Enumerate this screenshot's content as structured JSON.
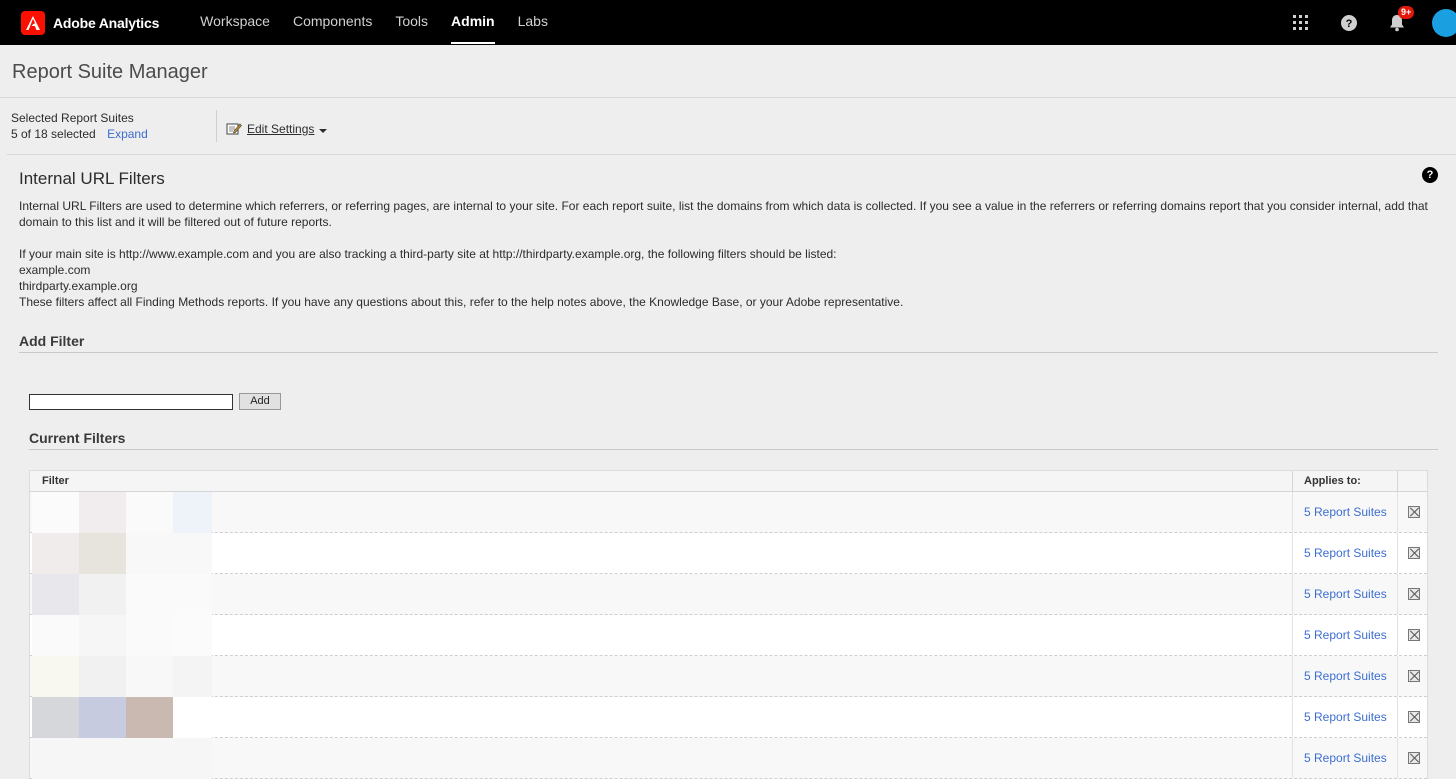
{
  "topbar": {
    "brand": "Adobe Analytics",
    "nav": [
      {
        "label": "Workspace",
        "active": false
      },
      {
        "label": "Components",
        "active": false
      },
      {
        "label": "Tools",
        "active": false
      },
      {
        "label": "Admin",
        "active": true
      },
      {
        "label": "Labs",
        "active": false
      }
    ],
    "notification_badge": "9+",
    "icons": [
      "apps-grid-icon",
      "help-icon",
      "bell-icon",
      "avatar"
    ]
  },
  "page": {
    "title": "Report Suite Manager"
  },
  "selected_suites": {
    "label": "Selected Report Suites",
    "count": "5 of 18 selected",
    "expand": "Expand"
  },
  "toolbar": {
    "edit_settings": "Edit Settings"
  },
  "section": {
    "title": "Internal URL Filters",
    "help": "?",
    "para1": "Internal URL Filters are used to determine which referrers, or referring pages, are internal to your site. For each report suite, list the domains from which data is collected. If you see a value in the referrers or referring domains report that you consider internal, add that domain to this list and it will be filtered out of future reports.",
    "para2": "If your main site is http://www.example.com and you are also tracking a third-party site at http://thirdparty.example.org, the following filters should be listed:",
    "example1": "example.com",
    "example2": "thirdparty.example.org",
    "para3": "These filters affect all Finding Methods reports. If you have any questions about this, refer to the help notes above, the Knowledge Base, or your Adobe representative."
  },
  "add_filter": {
    "heading": "Add Filter",
    "input_value": "",
    "button": "Add"
  },
  "current_filters": {
    "heading": "Current Filters",
    "columns": [
      "Filter",
      "Applies to:"
    ],
    "rows": [
      {
        "applies": "5 Report Suites"
      },
      {
        "applies": "5 Report Suites"
      },
      {
        "applies": "5 Report Suites"
      },
      {
        "applies": "5 Report Suites"
      },
      {
        "applies": "5 Report Suites"
      },
      {
        "applies": "5 Report Suites"
      },
      {
        "applies": "5 Report Suites"
      }
    ]
  },
  "colors": {
    "topbar_bg": "#000000",
    "page_bg": "#eeeeee",
    "link": "#3c6ed0",
    "adobe_red": "#fa0f00",
    "badge_red": "#e3170a",
    "avatar_blue": "#1a9fe0"
  }
}
